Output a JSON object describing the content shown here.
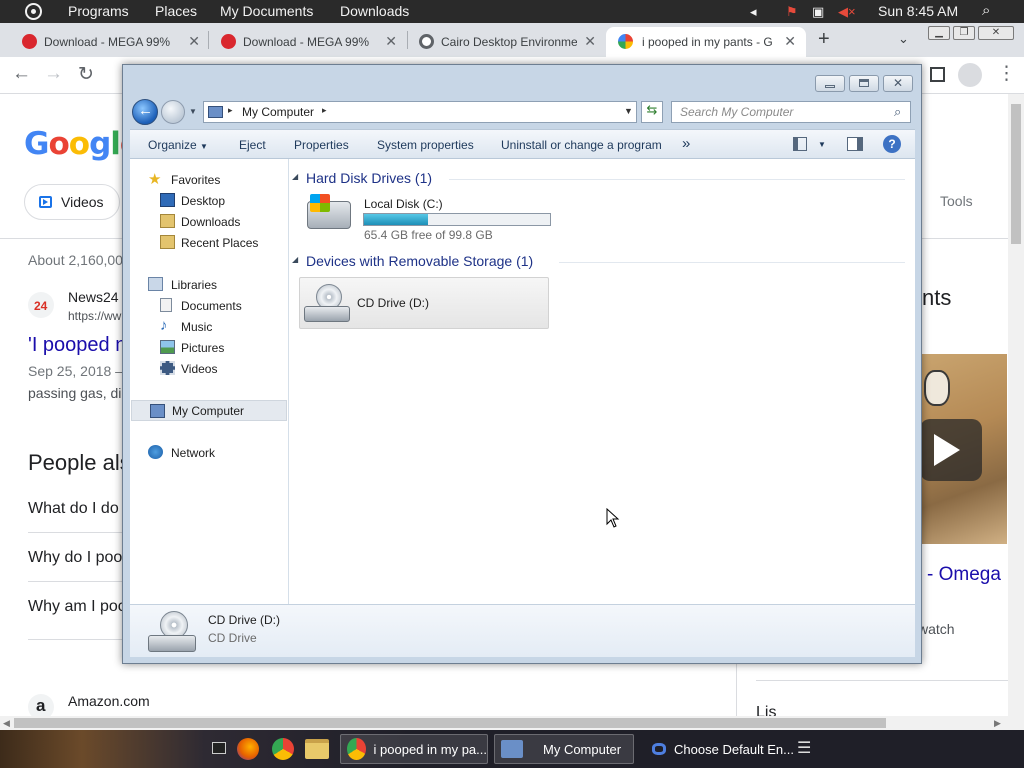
{
  "topbar": {
    "programs": "Programs",
    "places": "Places",
    "documents": "My Documents",
    "downloads": "Downloads",
    "clock": "Sun 8:45 AM"
  },
  "browser": {
    "tabs": [
      {
        "title": "Download - MEGA 99%",
        "icon": "mega-icon"
      },
      {
        "title": "Download - MEGA 99%",
        "icon": "mega-icon"
      },
      {
        "title": "Cairo Desktop Environme",
        "icon": "cairo-icon"
      },
      {
        "title": "i pooped in my pants - G",
        "icon": "google-icon"
      }
    ],
    "new_tab": "+"
  },
  "google": {
    "logo": [
      "G",
      "o",
      "o",
      "g",
      "l",
      "e"
    ],
    "logo_colors": [
      "#4285f4",
      "#ea4335",
      "#fbbc05",
      "#4285f4",
      "#34a853",
      "#ea4335"
    ],
    "chip_videos": "Videos",
    "tools": "Tools",
    "result_count": "About 2,160,00",
    "source_icon_text": "24",
    "source_name": "News24",
    "source_url": "https://ww",
    "result_title": "'I pooped n",
    "result_date": "Sep 25, 2018 —",
    "result_snippet": "passing gas, di",
    "paa_title": "People als",
    "paa_items": [
      "What do I do",
      "Why do I poo",
      "Why am I poc"
    ],
    "amazon_icon": "a",
    "amazon": "Amazon.com",
    "right_heading": "nts",
    "right_video_title": "- Omega",
    "right_video_meta": "watch",
    "right_bottom": "Lis"
  },
  "explorer": {
    "breadcrumb_root": "My Computer",
    "search_placeholder": "Search My Computer",
    "commands": [
      "Organize",
      "Eject",
      "Properties",
      "System properties",
      "Uninstall or change a program"
    ],
    "more": "»",
    "nav": {
      "favorites": "Favorites",
      "desktop": "Desktop",
      "downloads": "Downloads",
      "recent_places": "Recent Places",
      "libraries": "Libraries",
      "documents": "Documents",
      "music": "Music",
      "pictures": "Pictures",
      "videos": "Videos",
      "my_computer": "My Computer",
      "network": "Network"
    },
    "groups": {
      "hdd": "Hard Disk Drives (1)",
      "removable": "Devices with Removable Storage (1)"
    },
    "local_disk": {
      "name": "Local Disk (C:)",
      "free": "65.4 GB free of 99.8 GB",
      "used_fraction": 0.345
    },
    "cd_drive": {
      "name": "CD Drive (D:)"
    },
    "details": {
      "name": "CD Drive (D:)",
      "type": "CD Drive"
    }
  },
  "taskbar": {
    "items": [
      {
        "label": "i pooped in my pa...",
        "icon": "chrome-icon"
      },
      {
        "label": "My Computer",
        "icon": "computer-icon"
      },
      {
        "label": "Choose Default En...",
        "icon": "infinity-icon"
      }
    ]
  }
}
